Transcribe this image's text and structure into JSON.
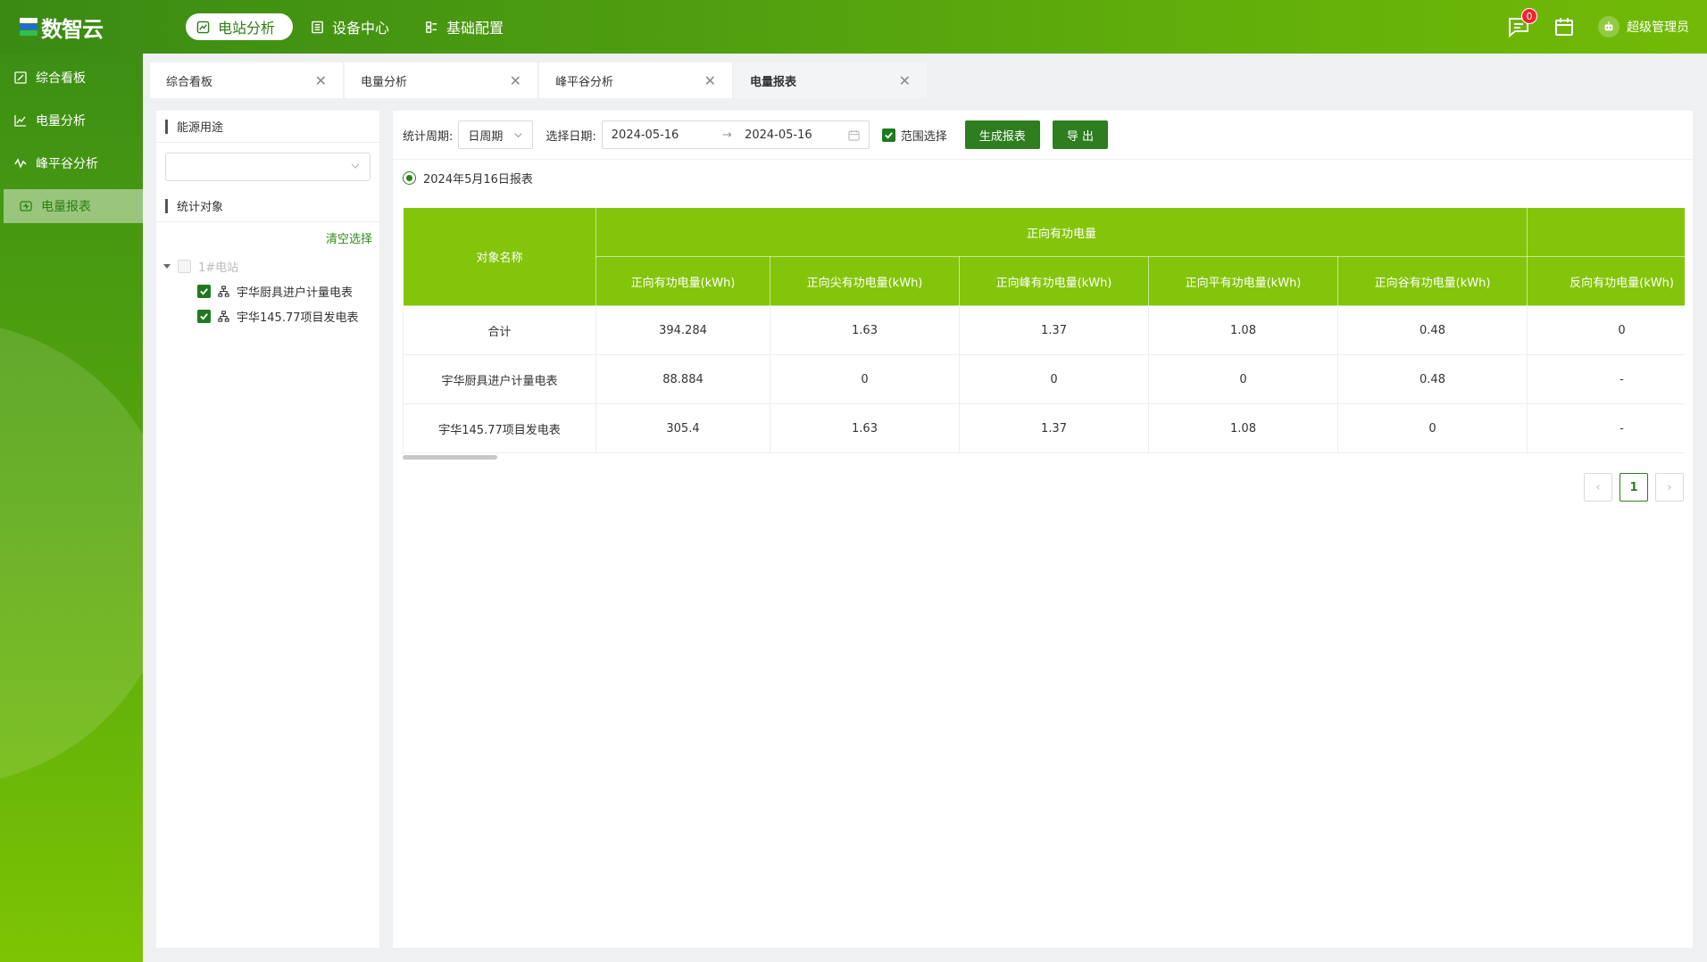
{
  "app": {
    "logo_text": "数智云"
  },
  "topnav": [
    {
      "label": "电站分析",
      "icon": "chart-icon",
      "active": true
    },
    {
      "label": "设备中心",
      "icon": "list-icon",
      "active": false
    },
    {
      "label": "基础配置",
      "icon": "config-icon",
      "active": false
    }
  ],
  "header": {
    "message_count": "0",
    "user_name": "超级管理员"
  },
  "sidebar": {
    "items": [
      {
        "label": "综合看板",
        "icon": "edit-icon"
      },
      {
        "label": "电量分析",
        "icon": "line-chart-icon"
      },
      {
        "label": "峰平谷分析",
        "icon": "wave-icon"
      },
      {
        "label": "电量报表",
        "icon": "report-icon",
        "active": true
      }
    ]
  },
  "tabs": [
    {
      "label": "综合看板"
    },
    {
      "label": "电量分析"
    },
    {
      "label": "峰平谷分析"
    },
    {
      "label": "电量报表",
      "active": true
    }
  ],
  "left_panel": {
    "energy_title": "能源用途",
    "energy_select_value": "",
    "object_title": "统计对象",
    "clear_label": "清空选择",
    "tree": {
      "root": "1#电站",
      "children": [
        {
          "label": "宇华厨具进户计量电表",
          "checked": true
        },
        {
          "label": "宇华145.77项目发电表",
          "checked": true
        }
      ]
    }
  },
  "filters": {
    "period_label": "统计周期:",
    "period_value": "日周期",
    "date_label": "选择日期:",
    "date_start": "2024-05-16",
    "date_arrow": "→",
    "date_end": "2024-05-16",
    "range_select_label": "范围选择",
    "generate_button": "生成报表",
    "export_button": "导 出"
  },
  "report": {
    "title": "2024年5月16日报表",
    "group_header": "正向有功电量",
    "name_header": "对象名称",
    "columns": [
      "正向有功电量(kWh)",
      "正向尖有功电量(kWh)",
      "正向峰有功电量(kWh)",
      "正向平有功电量(kWh)",
      "正向谷有功电量(kWh)",
      "反向有功电量(kWh)"
    ],
    "rows": [
      {
        "name": "合计",
        "values": [
          "394.284",
          "1.63",
          "1.37",
          "1.08",
          "0.48",
          "0"
        ]
      },
      {
        "name": "宇华厨具进户计量电表",
        "values": [
          "88.884",
          "0",
          "0",
          "0",
          "0.48",
          "-"
        ]
      },
      {
        "name": "宇华145.77项目发电表",
        "values": [
          "305.4",
          "1.63",
          "1.37",
          "1.08",
          "0",
          "-"
        ]
      }
    ]
  },
  "pagination": {
    "current": "1",
    "prev": "‹",
    "next": "›"
  },
  "colors": {
    "accent": "#2e7d1f",
    "header_green": "#83c50a",
    "topbar_start": "#3a8a14",
    "topbar_end": "#72ba06"
  }
}
